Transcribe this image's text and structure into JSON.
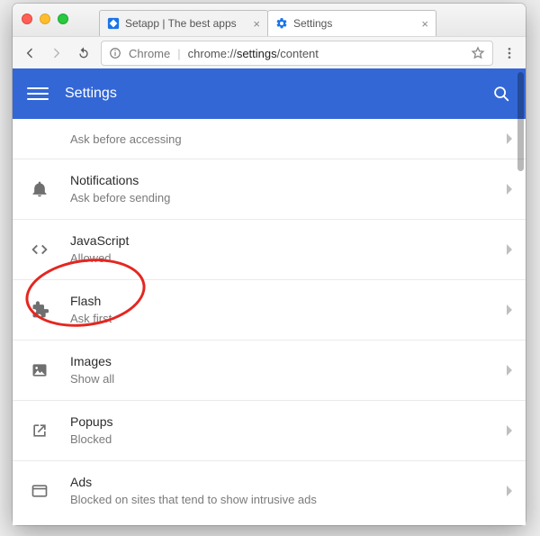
{
  "tabs": [
    {
      "title": "Setapp | The best apps",
      "active": false
    },
    {
      "title": "Settings",
      "active": true
    }
  ],
  "omnibox": {
    "scheme": "Chrome",
    "url_prefix": "chrome://",
    "url_emph": "settings",
    "url_suffix": "/content"
  },
  "header": {
    "title": "Settings"
  },
  "rows": [
    {
      "id": "location",
      "title": "",
      "subtitle": "Ask before accessing",
      "icon": "location-icon"
    },
    {
      "id": "notifications",
      "title": "Notifications",
      "subtitle": "Ask before sending",
      "icon": "bell-icon"
    },
    {
      "id": "javascript",
      "title": "JavaScript",
      "subtitle": "Allowed",
      "icon": "code-icon"
    },
    {
      "id": "flash",
      "title": "Flash",
      "subtitle": "Ask first",
      "icon": "extension-icon"
    },
    {
      "id": "images",
      "title": "Images",
      "subtitle": "Show all",
      "icon": "image-icon"
    },
    {
      "id": "popups",
      "title": "Popups",
      "subtitle": "Blocked",
      "icon": "open-in-new-icon"
    },
    {
      "id": "ads",
      "title": "Ads",
      "subtitle": "Blocked on sites that tend to show intrusive ads",
      "icon": "window-icon"
    }
  ],
  "annotation": {
    "target_row": "flash",
    "shape": "ellipse",
    "color": "#e52620"
  },
  "colors": {
    "header_bg": "#3367d6",
    "text_primary": "#2b2b2b",
    "text_secondary": "#7a7a7a"
  }
}
